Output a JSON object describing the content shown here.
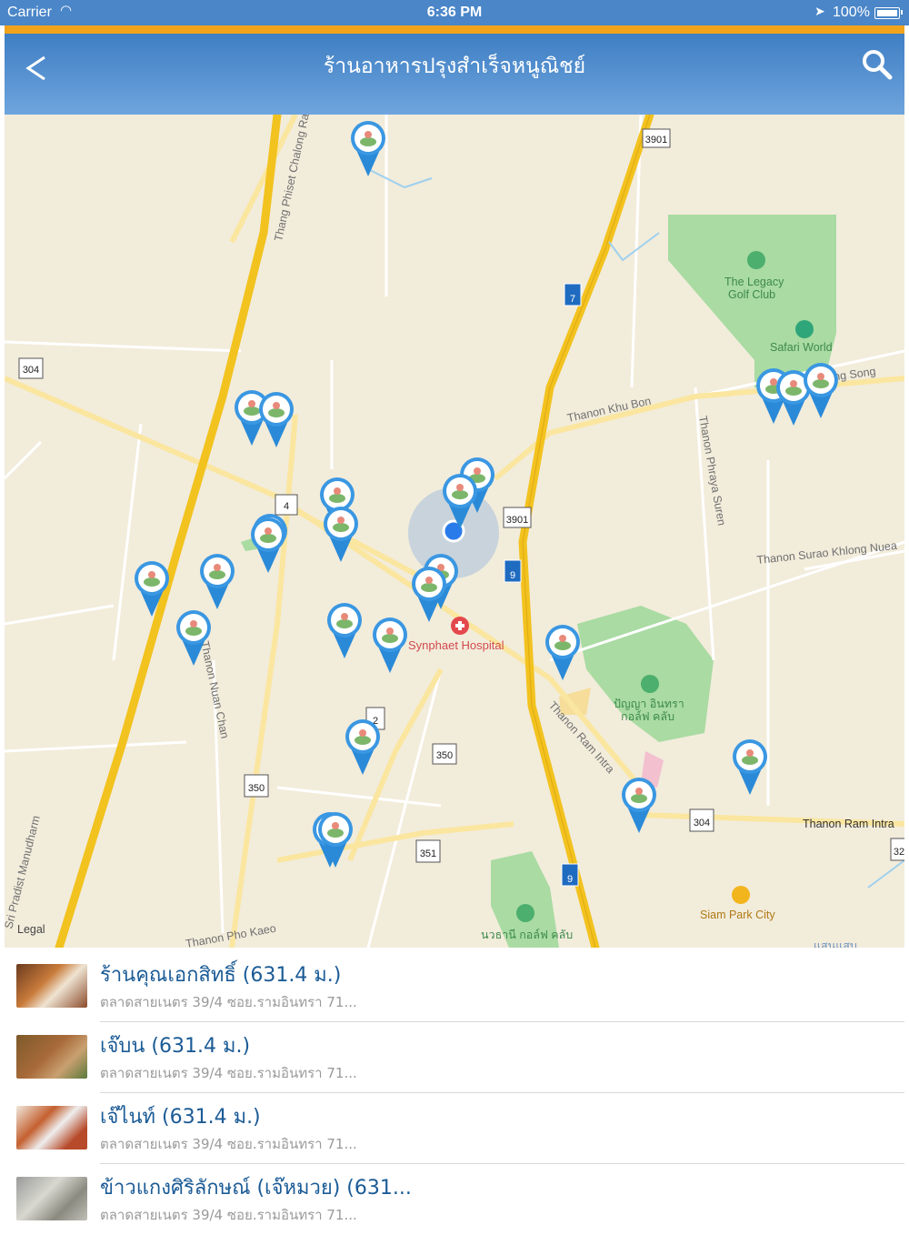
{
  "status_bar": {
    "carrier": "Carrier",
    "time": "6:36 PM",
    "battery": "100%"
  },
  "nav": {
    "title": "ร้านอาหารปรุงสำเร็จหนูณิชย์"
  },
  "map": {
    "legal": "Legal",
    "labels": {
      "hospital": "Synphaet Hospital",
      "golf1": "The Legacy",
      "golf1b": "Golf Club",
      "safari": "Safari World",
      "road_chalong": "Thang Phiset Chalong Rat",
      "road_khubon": "Thanon Khu Bon",
      "road_khlongsong": "Khlong Song",
      "road_phraya": "Thanon Phraya Suren",
      "road_surao": "Thanon Surao Khlong Nuea",
      "road_nuanchan": "Thanon Nuan Chan",
      "road_ramintra": "Thanon Ram Intra",
      "road_ramintra2": "Thanon Ram Intra",
      "golf2": "ปัญญา อินทรา",
      "golf2b": "กอล์ฟ คลับ",
      "siam": "Siam Park City",
      "road_phokaeo": "Thanon Pho Kaeo",
      "road_manudharm": "Sri Pradist Manudharm",
      "golf3": "นวธานี กอล์ฟ คลับ",
      "bottom_right": "แสนแสบ"
    },
    "shields": {
      "s3901a": "3901",
      "s7": "7",
      "s304a": "304",
      "s3901b": "3901",
      "s9a": "9",
      "s350a": "350",
      "s350b": "350",
      "s304b": "304",
      "s351": "351",
      "s9b": "9",
      "s32": "32",
      "s14": "4",
      "s2": "2"
    }
  },
  "list": [
    {
      "name": "ร้านคุณเอกสิทธิ์ (631.4 ม.)",
      "address": "ตลาดสายเนตร 39/4 ซอย.รามอินทรา 71..."
    },
    {
      "name": "เจ๊บน (631.4 ม.)",
      "address": "ตลาดสายเนตร 39/4 ซอย.รามอินทรา 71..."
    },
    {
      "name": "เจ๊ไนท์ (631.4 ม.)",
      "address": "ตลาดสายเนตร 39/4 ซอย.รามอินทรา 71..."
    },
    {
      "name": "ข้าวแกงศิริลักษณ์ (เจ๊หมวย) (631...",
      "address": "ตลาดสายเนตร 39/4 ซอย.รามอินทรา 71..."
    }
  ],
  "colors": {
    "accent": "#f1a31b",
    "nav": "#4a86c8",
    "pin": "#2a8ad8",
    "highway": "#f2c21f"
  }
}
